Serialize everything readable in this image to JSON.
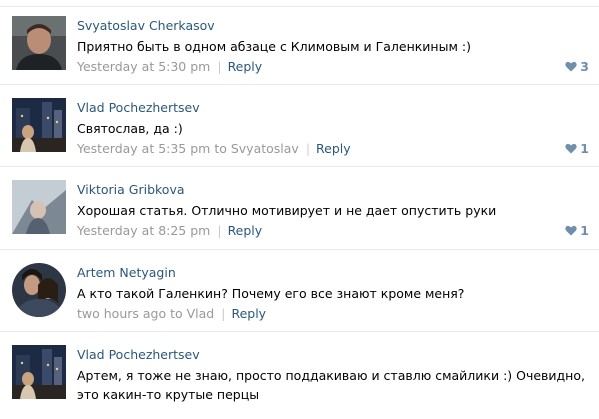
{
  "comments": [
    {
      "author": "Svyatoslav Cherkasov",
      "text": "Приятно быть в одном абзаце с Климовым и Галенкиным :)",
      "time": "Yesterday at 5:30 pm",
      "reply_to": "",
      "reply_label": "Reply",
      "likes": "3"
    },
    {
      "author": "Vlad Pochezhertsev",
      "text": "Святослав, да :)",
      "time": "Yesterday at 5:35 pm to Svyatoslav",
      "reply_to": "",
      "reply_label": "Reply",
      "likes": "1"
    },
    {
      "author": "Viktoria Gribkova",
      "text": "Хорошая статья. Отлично мотивирует и не дает опустить руки",
      "time": "Yesterday at 8:25 pm",
      "reply_to": "",
      "reply_label": "Reply",
      "likes": "1"
    },
    {
      "author": "Artem Netyagin",
      "text": "А кто такой Галенкин? Почему его все знают кроме меня?",
      "time": "two hours ago to Vlad",
      "reply_to": "",
      "reply_label": "Reply",
      "likes": ""
    },
    {
      "author": "Vlad Pochezhertsev",
      "text": "Артем, я тоже не знаю, просто поддакиваю и ставлю смайлики :) Очевидно, это какин-то крутые перцы",
      "time": "",
      "reply_to": "",
      "reply_label": "",
      "likes": ""
    }
  ],
  "colors": {
    "link": "#2b587a",
    "meta": "#999999",
    "like": "#6f8fac",
    "divider": "#e7eaed"
  },
  "icons": {
    "like": "heart-icon"
  }
}
